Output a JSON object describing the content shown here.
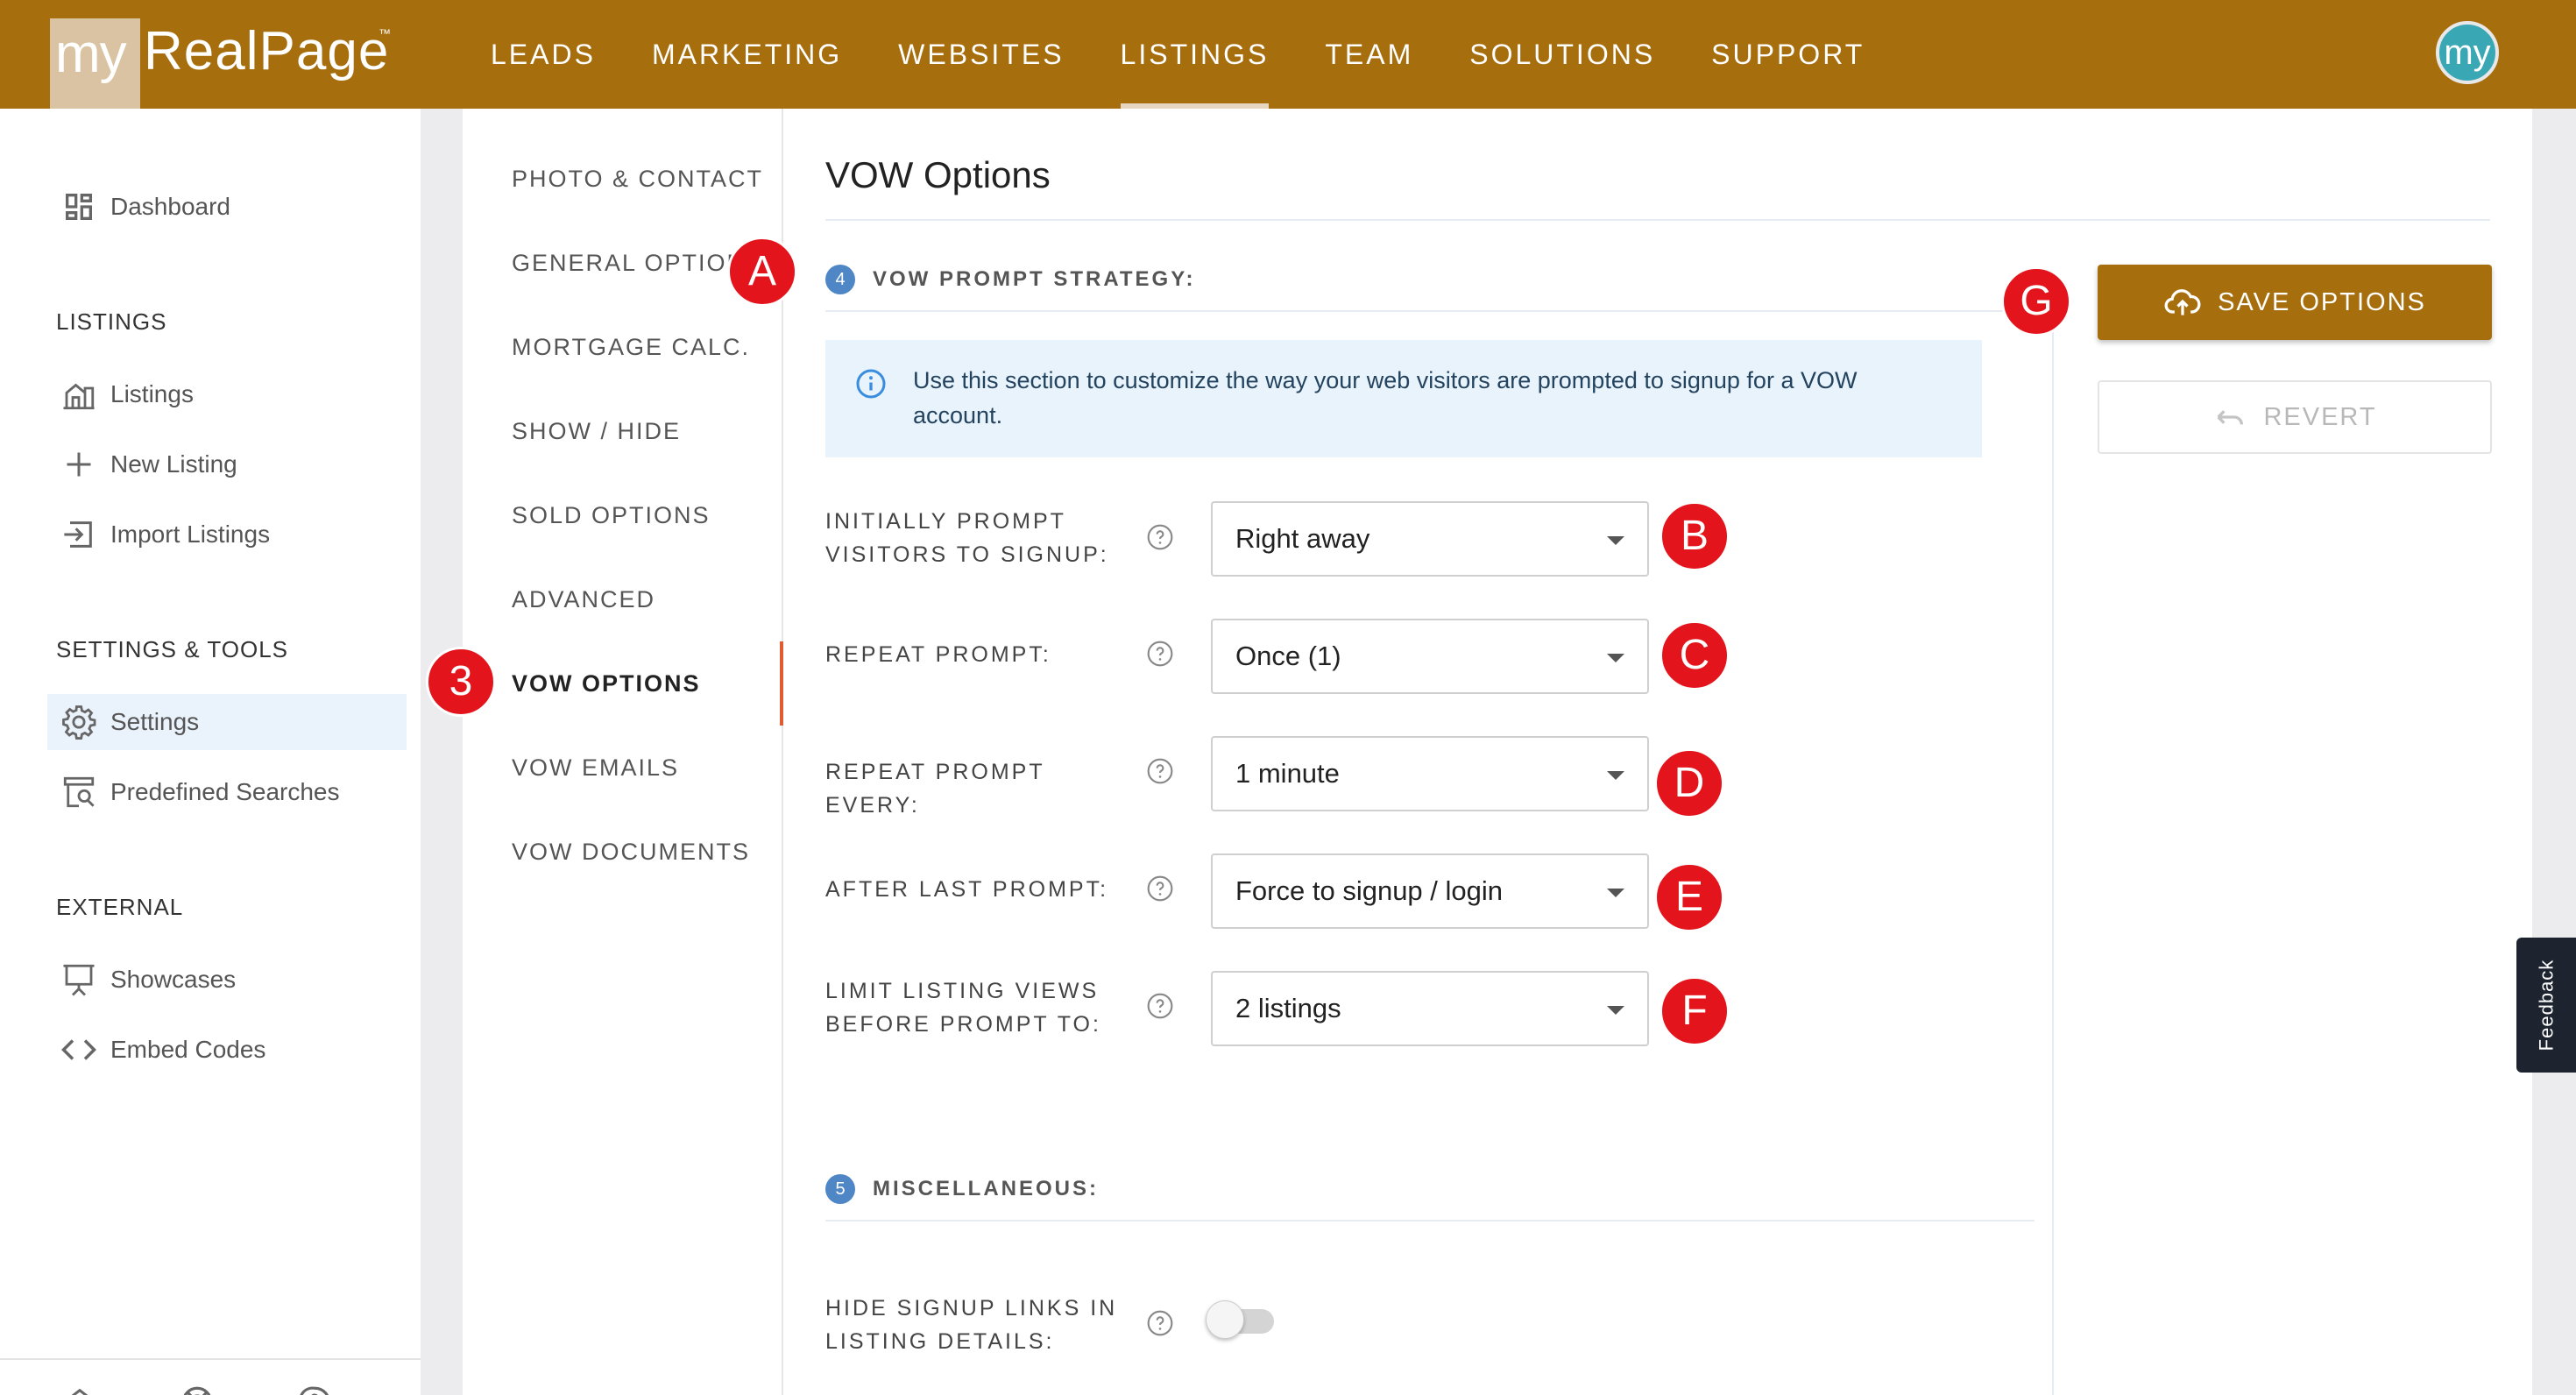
{
  "brand": {
    "logo_prefix": "my",
    "logo_name": "RealPage",
    "logo_tm": "™",
    "accent": "#a76e0e"
  },
  "topnav": {
    "items": [
      {
        "label": "LEADS"
      },
      {
        "label": "MARKETING"
      },
      {
        "label": "WEBSITES"
      },
      {
        "label": "LISTINGS",
        "active": true
      },
      {
        "label": "TEAM"
      },
      {
        "label": "SOLUTIONS"
      },
      {
        "label": "SUPPORT"
      }
    ],
    "avatar_text": "my"
  },
  "sidebar": {
    "dashboard": {
      "label": "Dashboard",
      "icon": "dashboard-icon"
    },
    "listings_header": "LISTINGS",
    "listings_items": [
      {
        "label": "Listings",
        "icon": "building-icon"
      },
      {
        "label": "New Listing",
        "icon": "plus-icon"
      },
      {
        "label": "Import Listings",
        "icon": "import-icon"
      }
    ],
    "settings_header": "SETTINGS & TOOLS",
    "settings_items": [
      {
        "label": "Settings",
        "icon": "gear-icon",
        "active": true
      },
      {
        "label": "Predefined Searches",
        "icon": "search-list-icon"
      }
    ],
    "external_header": "EXTERNAL",
    "external_items": [
      {
        "label": "Showcases",
        "icon": "easel-icon"
      },
      {
        "label": "Embed Codes",
        "icon": "code-icon"
      }
    ],
    "footer_icons": [
      "home-icon",
      "lifebuoy-icon",
      "help-chat-icon"
    ]
  },
  "settings_nav": {
    "items": [
      {
        "label": "PHOTO & CONTACT"
      },
      {
        "label": "GENERAL OPTIONS"
      },
      {
        "label": "MORTGAGE CALC."
      },
      {
        "label": "SHOW / HIDE"
      },
      {
        "label": "SOLD OPTIONS"
      },
      {
        "label": "ADVANCED"
      },
      {
        "label": "VOW OPTIONS",
        "active": true
      },
      {
        "label": "VOW EMAILS"
      },
      {
        "label": "VOW DOCUMENTS"
      }
    ]
  },
  "main": {
    "title": "VOW Options",
    "section1": {
      "step": "4",
      "title": "VOW PROMPT STRATEGY:",
      "info": "Use this section to customize the way your web visitors are prompted to signup for a VOW account."
    },
    "fields": [
      {
        "label_line1": "INITIALLY PROMPT",
        "label_line2": "VISITORS TO SIGNUP:",
        "value": "Right away"
      },
      {
        "label_line1": "REPEAT PROMPT:",
        "label_line2": "",
        "value": "Once (1)"
      },
      {
        "label_line1": "REPEAT PROMPT EVERY:",
        "label_line2": "",
        "value": "1 minute"
      },
      {
        "label_line1": "AFTER LAST PROMPT:",
        "label_line2": "",
        "value": "Force to signup / login"
      },
      {
        "label_line1": "LIMIT LISTING VIEWS",
        "label_line2": "BEFORE PROMPT TO:",
        "value": "2 listings"
      }
    ],
    "section2": {
      "step": "5",
      "title": "MISCELLANEOUS:"
    },
    "toggle_field": {
      "label_line1": "HIDE SIGNUP LINKS IN",
      "label_line2": "LISTING DETAILS:",
      "on": false
    },
    "save_label": "SAVE OPTIONS",
    "revert_label": "REVERT"
  },
  "markers": {
    "a": "A",
    "b": "B",
    "c": "C",
    "d": "D",
    "e": "E",
    "f": "F",
    "g": "G",
    "three": "3",
    "color": "#e3141b"
  },
  "feedback_label": "Feedback"
}
